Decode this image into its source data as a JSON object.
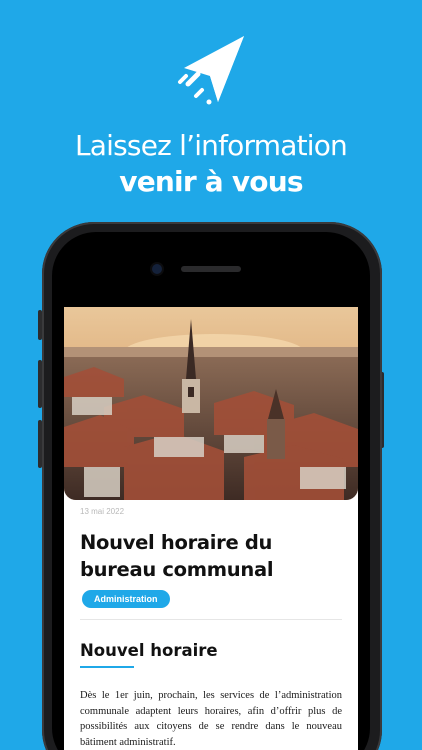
{
  "promo": {
    "headline_line1": "Laissez l’information",
    "headline_line2": "venir à vous"
  },
  "article": {
    "date": "13 mai 2022",
    "title": "Nouvel horaire du bureau communal",
    "category_tag": "Administration",
    "section_title": "Nouvel horaire",
    "body": "Dès le 1er juin, prochain, les services de l’administration communale adaptent leurs horaires, afin d’offrir plus de possibilités aux citoyens de se rendre dans le nouveau bâtiment administratif."
  },
  "icons": {
    "logo": "paper-plane-icon"
  },
  "colors": {
    "background": "#1fa8e8",
    "accent": "#1fa8e8",
    "tag_text": "#ffffff"
  }
}
